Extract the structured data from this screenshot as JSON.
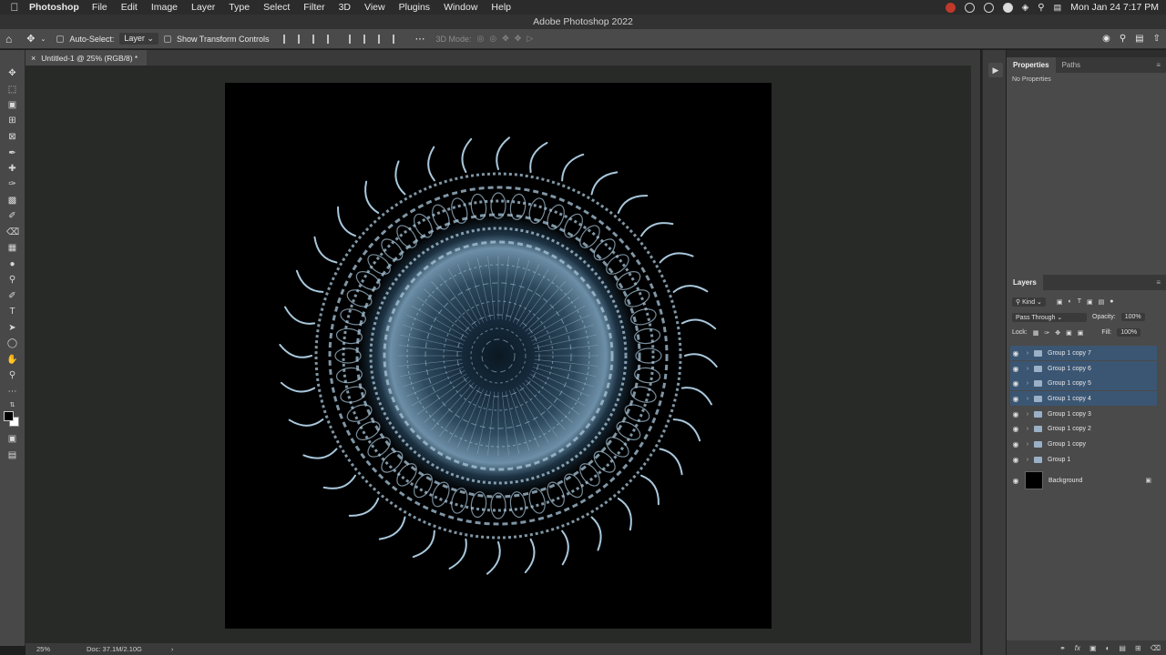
{
  "menubar": {
    "app": "Photoshop",
    "items": [
      "File",
      "Edit",
      "Image",
      "Layer",
      "Type",
      "Select",
      "Filter",
      "3D",
      "View",
      "Plugins",
      "Window",
      "Help"
    ],
    "clock": "Mon Jan 24  7:17 PM"
  },
  "window_title": "Adobe Photoshop 2022",
  "options": {
    "auto_select_label": "Auto-Select:",
    "auto_select_value": "Layer",
    "transform_label": "Show Transform Controls",
    "mode_3d": "3D Mode:"
  },
  "document": {
    "tab_title": "Untitled-1 @ 25% (RGB/8) *"
  },
  "status": {
    "zoom": "25%",
    "doc_info": "Doc: 37.1M/2.10G"
  },
  "properties": {
    "tabs": [
      "Properties",
      "Paths"
    ],
    "empty_text": "No Properties"
  },
  "layers": {
    "title": "Layers",
    "filter_kind": "Kind",
    "blend_mode": "Pass Through",
    "opacity_label": "Opacity:",
    "opacity": "100%",
    "lock_label": "Lock:",
    "fill_label": "Fill:",
    "fill": "100%",
    "items": [
      {
        "name": "Group 1 copy 7",
        "selected": true
      },
      {
        "name": "Group 1 copy 6",
        "selected": true
      },
      {
        "name": "Group 1 copy 5",
        "selected": true
      },
      {
        "name": "Group 1 copy 4",
        "selected": true
      },
      {
        "name": "Group 1 copy 3",
        "selected": false
      },
      {
        "name": "Group 1 copy 2",
        "selected": false
      },
      {
        "name": "Group 1 copy",
        "selected": false
      },
      {
        "name": "Group 1",
        "selected": false
      }
    ],
    "background": "Background"
  },
  "colors": {
    "selection": "#3b5673",
    "mandala": "#a9c8dc"
  }
}
